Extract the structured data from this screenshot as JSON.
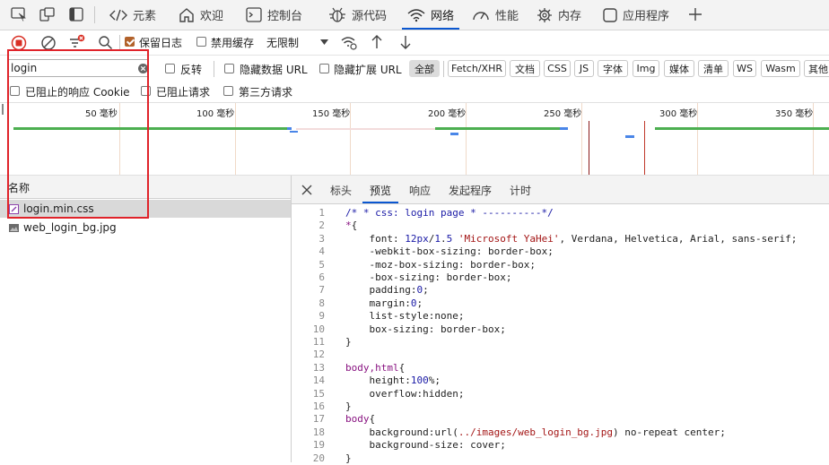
{
  "tabs": [
    {
      "label": "元素",
      "icon": "code-icon"
    },
    {
      "label": "欢迎",
      "icon": "home-icon"
    },
    {
      "label": "控制台",
      "icon": "console-icon"
    },
    {
      "label": "源代码",
      "icon": "bug-icon"
    },
    {
      "label": "网络",
      "icon": "wifi-icon",
      "active": true
    },
    {
      "label": "性能",
      "icon": "gauge-icon"
    },
    {
      "label": "内存",
      "icon": "memory-icon"
    },
    {
      "label": "应用程序",
      "icon": "app-icon"
    }
  ],
  "toolbar": {
    "preserve_log": "保留日志",
    "disable_cache": "禁用缓存",
    "throttle": "无限制"
  },
  "filter": {
    "search_value": "login",
    "invert": "反转",
    "hide_data_url": "隐藏数据 URL",
    "hide_ext_url": "隐藏扩展 URL",
    "types": [
      "全部",
      "Fetch/XHR",
      "文档",
      "CSS",
      "JS",
      "字体",
      "Img",
      "媒体",
      "清单",
      "WS",
      "Wasm",
      "其他"
    ],
    "blocked_cookies": "已阻止的响应 Cookie",
    "blocked_requests": "已阻止请求",
    "third_party": "第三方请求"
  },
  "overview": {
    "tick_labels": [
      "50 毫秒",
      "100 毫秒",
      "150 毫秒",
      "200 毫秒",
      "250 毫秒",
      "300 毫秒",
      "350 毫秒"
    ]
  },
  "requests": {
    "header": "名称",
    "rows": [
      {
        "name": "login.min.css",
        "icon": "css-file-icon",
        "selected": true
      },
      {
        "name": "web_login_bg.jpg",
        "icon": "image-file-icon",
        "selected": false
      }
    ]
  },
  "detail": {
    "tabs": [
      "标头",
      "预览",
      "响应",
      "发起程序",
      "计时"
    ],
    "active_tab": "预览",
    "code_lines": [
      "/* * css: login page * ----------*/",
      "*{",
      "    font: 12px/1.5 'Microsoft YaHei', Verdana, Helvetica, Arial, sans-serif;",
      "    -webkit-box-sizing: border-box;",
      "    -moz-box-sizing: border-box;",
      "    -box-sizing: border-box;",
      "    padding:0;",
      "    margin:0;",
      "    list-style:none;",
      "    box-sizing: border-box;",
      "}",
      "",
      "body,html{",
      "    height:100%;",
      "    overflow:hidden;",
      "}",
      "body{",
      "    background:url(../images/web_login_bg.jpg) no-repeat center;",
      "    background-size: cover;",
      "}"
    ]
  },
  "colors": {
    "accent": "#0b57d0",
    "record": "#d93025",
    "highlight_box": "#e0232a",
    "timeline_green": "#4caf50",
    "timeline_blue": "#4a86e8"
  }
}
